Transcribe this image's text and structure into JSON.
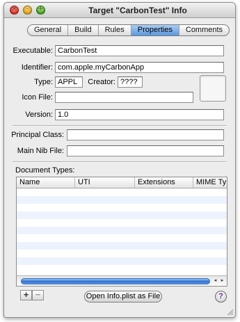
{
  "window": {
    "title": "Target \"CarbonTest\" Info"
  },
  "titlebar": {
    "close_glyph": "×",
    "minimize_glyph": "–",
    "zoom_glyph": "+"
  },
  "tabs": [
    {
      "label": "General",
      "active": false
    },
    {
      "label": "Build",
      "active": false
    },
    {
      "label": "Rules",
      "active": false
    },
    {
      "label": "Properties",
      "active": true
    },
    {
      "label": "Comments",
      "active": false
    }
  ],
  "form": {
    "executable": {
      "label": "Executable:",
      "value": "CarbonTest"
    },
    "identifier": {
      "label": "Identifier:",
      "value": "com.apple.myCarbonApp"
    },
    "type": {
      "label": "Type:",
      "value": "APPL"
    },
    "creator": {
      "label": "Creator:",
      "value": "????"
    },
    "icon_file": {
      "label": "Icon File:",
      "value": ""
    },
    "version": {
      "label": "Version:",
      "value": "1.0"
    },
    "principal_class": {
      "label": "Principal Class:",
      "value": ""
    },
    "main_nib_file": {
      "label": "Main Nib File:",
      "value": ""
    }
  },
  "document_types": {
    "label": "Document Types:",
    "columns": [
      "Name",
      "UTI",
      "Extensions",
      "MIME Typ"
    ],
    "rows": []
  },
  "scrollbar": {
    "left_arrow": "◂",
    "right_arrow": "▸"
  },
  "footer": {
    "add_label": "+",
    "remove_label": "−",
    "open_plist_label": "Open Info.plist as File",
    "help_label": "?"
  },
  "colors": {
    "selected_tab": "#5b98e0",
    "row_stripe": "#edf3fe",
    "scroll_thumb": "#2f6fd0"
  }
}
